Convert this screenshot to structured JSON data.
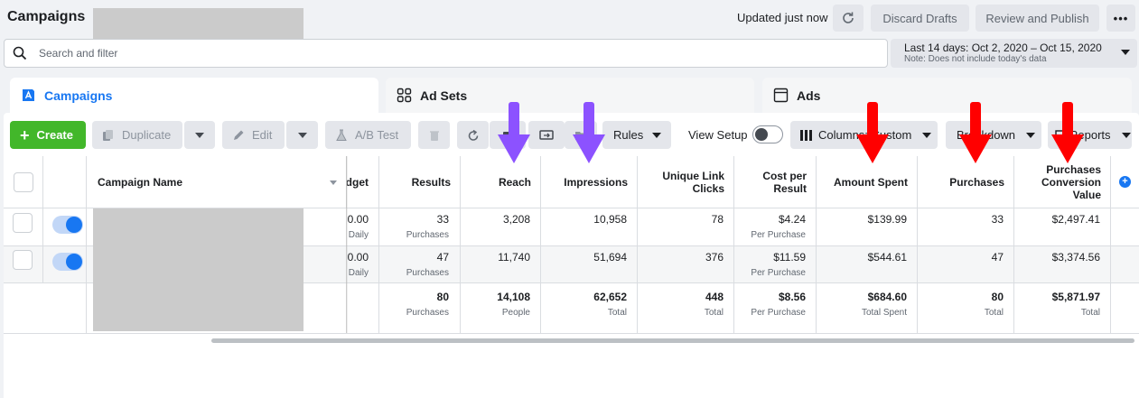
{
  "header": {
    "title": "Campaigns",
    "updated": "Updated just now",
    "discard": "Discard Drafts",
    "review": "Review and Publish",
    "more": "•••"
  },
  "search": {
    "placeholder": "Search and filter"
  },
  "date": {
    "range": "Last 14 days: Oct 2, 2020 – Oct 15, 2020",
    "note": "Note: Does not include today's data"
  },
  "tabs": [
    {
      "label": "Campaigns",
      "icon": "campaign-icon"
    },
    {
      "label": "Ad Sets",
      "icon": "grid-icon"
    },
    {
      "label": "Ads",
      "icon": "window-icon"
    }
  ],
  "toolbar": {
    "create": "Create",
    "duplicate": "Duplicate",
    "edit": "Edit",
    "ab_test": "A/B Test",
    "rules": "Rules",
    "view_setup": "View Setup",
    "columns": "Columns: Custom",
    "breakdown": "Breakdown",
    "reports": "Reports"
  },
  "table": {
    "headers": {
      "name": "Campaign Name",
      "budget": "Budget",
      "results": "Results",
      "reach": "Reach",
      "impressions": "Impressions",
      "unique_link_clicks": "Unique Link Clicks",
      "cost_per_result": "Cost per Result",
      "amount_spent": "Amount Spent",
      "purchases": "Purchases",
      "purchases_conv_value": "Purchases Conversion Value"
    },
    "rows": [
      {
        "budget": "0.00",
        "budget_sub": "Daily",
        "results": "33",
        "results_sub": "Purchases",
        "reach": "3,208",
        "impressions": "10,958",
        "clicks": "78",
        "cpr": "$4.24",
        "cpr_sub": "Per Purchase",
        "spent": "$139.99",
        "purchases": "33",
        "conv_value": "$2,497.41"
      },
      {
        "budget": "0.00",
        "budget_sub": "Daily",
        "results": "47",
        "results_sub": "Purchases",
        "reach": "11,740",
        "impressions": "51,694",
        "clicks": "376",
        "cpr": "$11.59",
        "cpr_sub": "Per Purchase",
        "spent": "$544.61",
        "purchases": "47",
        "conv_value": "$3,374.56"
      }
    ],
    "totals": {
      "results": "80",
      "results_sub": "Purchases",
      "reach": "14,108",
      "reach_sub": "People",
      "impressions": "62,652",
      "impressions_sub": "Total",
      "clicks": "448",
      "clicks_sub": "Total",
      "cpr": "$8.56",
      "cpr_sub": "Per Purchase",
      "spent": "$684.60",
      "spent_sub": "Total Spent",
      "purchases": "80",
      "purchases_sub": "Total",
      "conv_value": "$5,871.97",
      "conv_value_sub": "Total"
    }
  },
  "annotations": {
    "purple": "#8c52ff",
    "red": "#ff0000"
  },
  "colors": {
    "accent": "#1877f2",
    "create": "#42b72a"
  }
}
